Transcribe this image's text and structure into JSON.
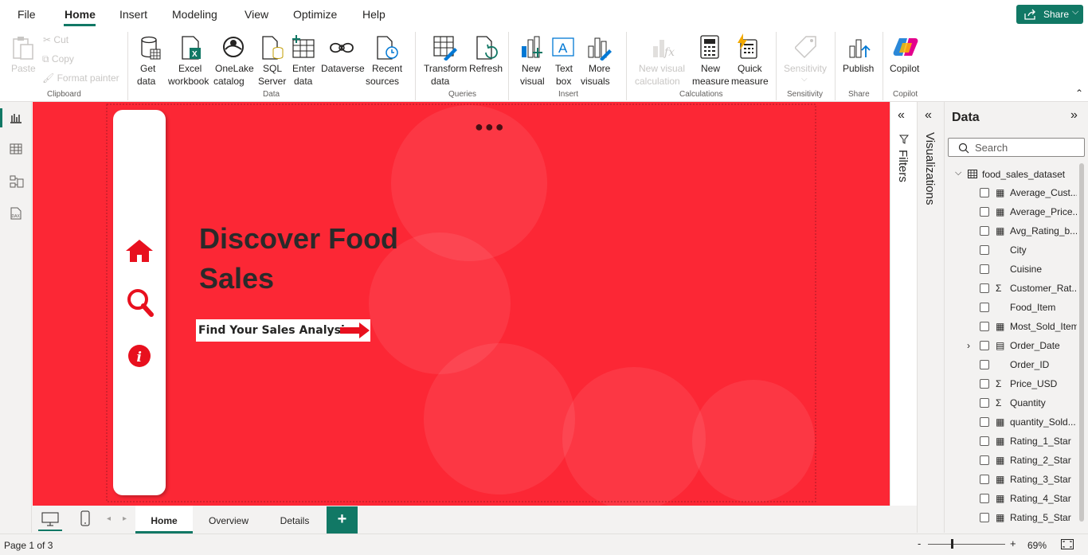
{
  "menu": {
    "items": [
      "File",
      "Home",
      "Insert",
      "Modeling",
      "View",
      "Optimize",
      "Help"
    ],
    "share_label": "Share"
  },
  "ribbon": {
    "clipboard": {
      "paste": "Paste",
      "cut": "Cut",
      "copy": "Copy",
      "format_painter": "Format painter",
      "group": "Clipboard"
    },
    "data": {
      "get_data": [
        "Get",
        "data"
      ],
      "excel": [
        "Excel",
        "workbook"
      ],
      "onelake": [
        "OneLake",
        "catalog"
      ],
      "sql": [
        "SQL",
        "Server"
      ],
      "enter": [
        "Enter",
        "data"
      ],
      "dataverse": "Dataverse",
      "recent": [
        "Recent",
        "sources"
      ],
      "group": "Data"
    },
    "queries": {
      "transform": [
        "Transform",
        "data"
      ],
      "refresh": "Refresh",
      "group": "Queries"
    },
    "insert": {
      "new_visual": [
        "New",
        "visual"
      ],
      "text_box": [
        "Text",
        "box"
      ],
      "more_visuals": [
        "More",
        "visuals"
      ],
      "group": "Insert"
    },
    "calculations": {
      "new_visual_calc": [
        "New visual",
        "calculation"
      ],
      "new_measure": [
        "New",
        "measure"
      ],
      "quick_measure": [
        "Quick",
        "measure"
      ],
      "group": "Calculations"
    },
    "sensitivity": {
      "label": "Sensitivity",
      "group": "Sensitivity"
    },
    "share": {
      "publish": "Publish",
      "group": "Share"
    },
    "copilot": {
      "label": "Copilot",
      "group": "Copilot"
    }
  },
  "report": {
    "title_line1": "Discover Food",
    "title_line2": "Sales",
    "cta": "Find Your Sales Analysis",
    "more_dots": "●●●",
    "colors": {
      "background": "#fc2735",
      "accent": "#e8101e",
      "card": "#ffffff"
    }
  },
  "panes": {
    "filters": "Filters",
    "visualizations": "Visualizations",
    "data_title": "Data",
    "search_placeholder": "Search",
    "dataset": "food_sales_dataset",
    "fields": [
      {
        "name": "Average_Cust...",
        "icon": "calculator-icon"
      },
      {
        "name": "Average_Price...",
        "icon": "calculator-icon"
      },
      {
        "name": "Avg_Rating_b...",
        "icon": "calculator-icon"
      },
      {
        "name": "City",
        "icon": ""
      },
      {
        "name": "Cuisine",
        "icon": ""
      },
      {
        "name": "Customer_Rat...",
        "icon": "sigma-icon"
      },
      {
        "name": "Food_Item",
        "icon": ""
      },
      {
        "name": "Most_Sold_Item",
        "icon": "calculator-icon"
      },
      {
        "name": "Order_Date",
        "icon": "calendar-icon"
      },
      {
        "name": "Order_ID",
        "icon": ""
      },
      {
        "name": "Price_USD",
        "icon": "sigma-icon"
      },
      {
        "name": "Quantity",
        "icon": "sigma-icon"
      },
      {
        "name": "quantity_Sold...",
        "icon": "calculator-icon"
      },
      {
        "name": "Rating_1_Star",
        "icon": "calculator-icon"
      },
      {
        "name": "Rating_2_Star",
        "icon": "calculator-icon"
      },
      {
        "name": "Rating_3_Star",
        "icon": "calculator-icon"
      },
      {
        "name": "Rating_4_Star",
        "icon": "calculator-icon"
      },
      {
        "name": "Rating_5_Star",
        "icon": "calculator-icon"
      }
    ]
  },
  "tabs": [
    "Home",
    "Overview",
    "Details"
  ],
  "status": {
    "page": "Page 1 of 3",
    "zoom": "69%"
  }
}
